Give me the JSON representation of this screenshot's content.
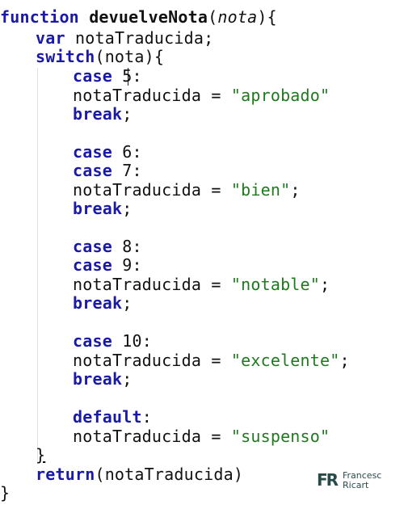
{
  "code": {
    "l1": {
      "kw": "function",
      "name": "devuelveNota",
      "open": "(",
      "param": "nota",
      "close": "){"
    },
    "l2": {
      "kw": "var",
      "rest": " notaTraducida;"
    },
    "l3": {
      "kw": "switch",
      "rest": "(nota){"
    },
    "l4": {
      "kw": "case",
      "val": " 5",
      "colon": ":"
    },
    "l5": {
      "lhs": "notaTraducida = ",
      "str": "\"aprobado\"",
      "end": ""
    },
    "l6": {
      "kw": "break",
      "end": ";"
    },
    "l7": {
      "kw": "case",
      "rest": " 6:"
    },
    "l8": {
      "kw": "case",
      "rest": " 7:"
    },
    "l9": {
      "lhs": "notaTraducida = ",
      "str": "\"bien\"",
      "end": ";"
    },
    "l10": {
      "kw": "break",
      "end": ";"
    },
    "l11": {
      "kw": "case",
      "rest": " 8:"
    },
    "l12": {
      "kw": "case",
      "rest": " 9:"
    },
    "l13": {
      "lhs": "notaTraducida = ",
      "str": "\"notable\"",
      "end": ";"
    },
    "l14": {
      "kw": "break",
      "end": ";"
    },
    "l15": {
      "kw": "case",
      "rest": " 10:"
    },
    "l16": {
      "lhs": "notaTraducida = ",
      "str": "\"excelente\"",
      "end": ";"
    },
    "l17": {
      "kw": "break",
      "end": ";"
    },
    "l18": {
      "kw": "default",
      "end": ":"
    },
    "l19": {
      "lhs": "notaTraducida = ",
      "str": "\"suspenso\"",
      "end": ""
    },
    "l20": {
      "brace": "}"
    },
    "l21": {
      "kw": "return",
      "rest": "(notaTraducida)"
    },
    "l22": {
      "brace": "}"
    }
  },
  "watermark": {
    "logo": "FR",
    "line1": "Francesc",
    "line2": "Ricart"
  },
  "colors": {
    "keyword": "#1a1aa6",
    "string": "#1f7a1f",
    "text": "#111111",
    "background": "#ffffff"
  }
}
